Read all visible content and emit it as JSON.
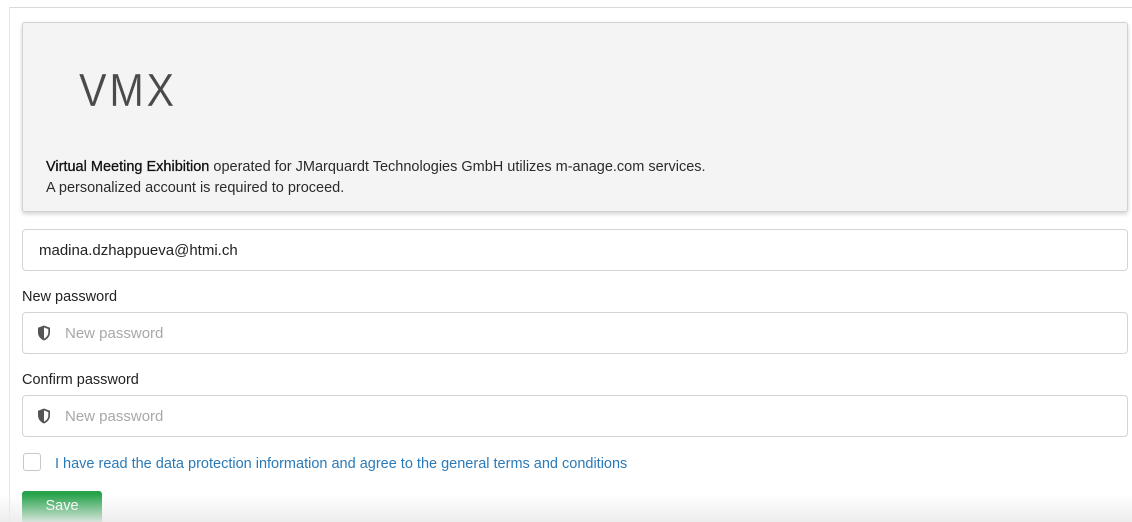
{
  "header": {
    "logo_text": "VMX",
    "intro_bold": "Virtual Meeting Exhibition",
    "intro_rest": " operated for JMarquardt Technologies GmbH utilizes m-anage.com services.",
    "intro_line2": "A personalized account is required to proceed."
  },
  "form": {
    "email_value": "madina.dzhappueva@htmi.ch",
    "new_password_label": "New password",
    "new_password_placeholder": "New password",
    "confirm_password_label": "Confirm password",
    "confirm_password_placeholder": "New password",
    "terms_text": "I have read the data protection information and agree to the general terms and conditions",
    "terms_checked": false,
    "save_label": "Save"
  },
  "icons": {
    "password_icon": "shield-icon"
  },
  "colors": {
    "accent_link": "#2a7ab8",
    "save_button": "#26a34a"
  }
}
